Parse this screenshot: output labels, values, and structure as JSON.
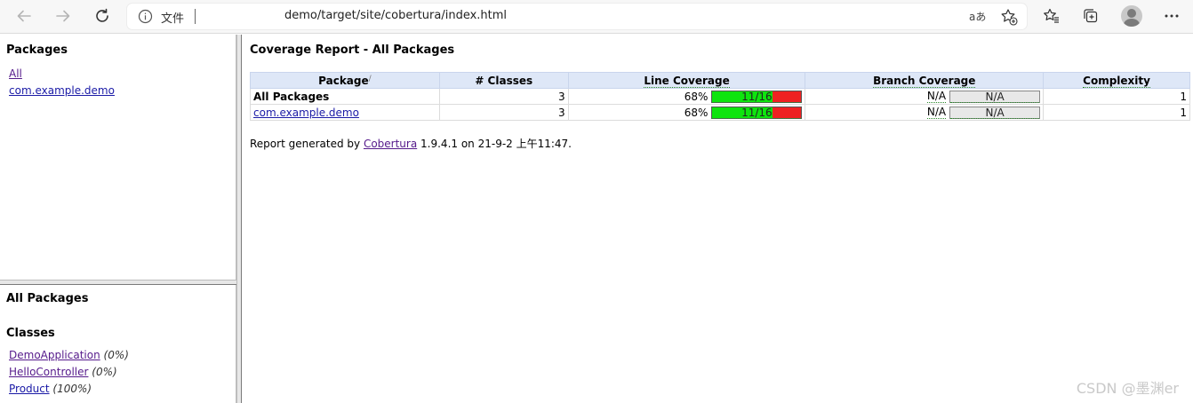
{
  "browser": {
    "scheme_label": "文件",
    "url": "demo/target/site/cobertura/index.html",
    "read_aloud_label": "aあ",
    "icons": [
      "back-icon",
      "forward-icon",
      "refresh-icon",
      "info-icon",
      "read-aloud-icon",
      "add-favorite-icon",
      "favorites-icon",
      "collections-icon",
      "profile-icon",
      "more-icon"
    ]
  },
  "packages_frame": {
    "title": "Packages",
    "items": [
      {
        "label": "All"
      },
      {
        "label": "com.example.demo"
      }
    ]
  },
  "classes_frame": {
    "scope_title": "All Packages",
    "title": "Classes",
    "items": [
      {
        "label": "DemoApplication",
        "pct": "(0%)"
      },
      {
        "label": "HelloController",
        "pct": "(0%)"
      },
      {
        "label": "Product",
        "pct": "(100%)"
      }
    ]
  },
  "report": {
    "title": "Coverage Report - All Packages",
    "columns": [
      "Package",
      "# Classes",
      "Line Coverage",
      "Branch Coverage",
      "Complexity"
    ],
    "sort_indicator": "/",
    "rows": [
      {
        "package": "All Packages",
        "classes": "3",
        "line_pct": "68%",
        "line_bar": "11/16",
        "line_fraction": 0.68,
        "branch_pct": "N/A",
        "branch_bar": "N/A",
        "complexity": "1"
      },
      {
        "package": "com.example.demo",
        "classes": "3",
        "line_pct": "68%",
        "line_bar": "11/16",
        "line_fraction": 0.68,
        "branch_pct": "N/A",
        "branch_bar": "N/A",
        "complexity": "1"
      }
    ],
    "footer_prefix": "Report generated by",
    "footer_link": "Cobertura",
    "footer_suffix": "1.9.4.1 on 21-9-2 上午11:47."
  },
  "watermark": "CSDN @墨渊er",
  "colors": {
    "covered": "#0ee40e",
    "uncovered": "#ee2121",
    "header_bg": "#dee7f7",
    "link": "#1a1aa6",
    "visited_link": "#551a8b"
  }
}
